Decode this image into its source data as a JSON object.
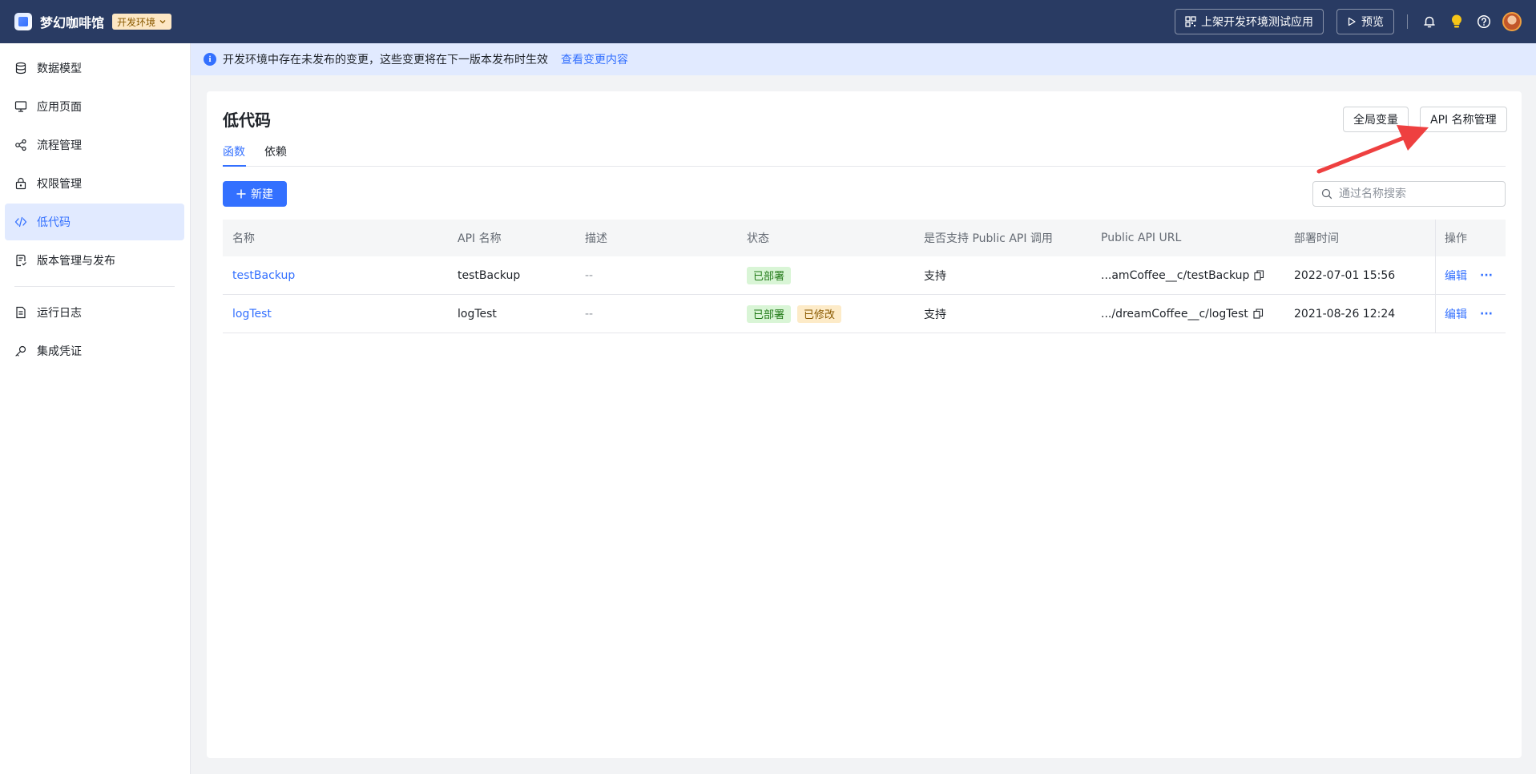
{
  "header": {
    "app_name": "梦幻咖啡馆",
    "env_label": "开发环境",
    "publish_test_app": "上架开发环境测试应用",
    "preview": "预览"
  },
  "sidebar": {
    "items": [
      {
        "label": "数据模型",
        "icon": "database-icon"
      },
      {
        "label": "应用页面",
        "icon": "monitor-icon"
      },
      {
        "label": "流程管理",
        "icon": "flow-icon"
      },
      {
        "label": "权限管理",
        "icon": "lock-icon"
      },
      {
        "label": "低代码",
        "icon": "code-icon",
        "active": true
      },
      {
        "label": "版本管理与发布",
        "icon": "version-icon"
      },
      {
        "label": "运行日志",
        "icon": "log-icon"
      },
      {
        "label": "集成凭证",
        "icon": "key-icon"
      }
    ]
  },
  "notice": {
    "text": "开发环境中存在未发布的变更，这些变更将在下一版本发布时生效",
    "link": "查看变更内容"
  },
  "main": {
    "title": "低代码",
    "global_vars": "全局变量",
    "api_name_mgmt": "API 名称管理",
    "tabs": [
      {
        "label": "函数",
        "active": true
      },
      {
        "label": "依赖",
        "active": false
      }
    ],
    "new_button": "新建",
    "search_placeholder": "通过名称搜索"
  },
  "table": {
    "headers": [
      "名称",
      "API 名称",
      "描述",
      "状态",
      "是否支持 Public API 调用",
      "Public API URL",
      "部署时间",
      "操作"
    ],
    "rows": [
      {
        "name": "testBackup",
        "api_name": "testBackup",
        "desc": "--",
        "status": [
          "已部署"
        ],
        "public_api": "支持",
        "url": "...amCoffee__c/testBackup",
        "deploy_time": "2022-07-01 15:56",
        "edit": "编辑",
        "more": "···"
      },
      {
        "name": "logTest",
        "api_name": "logTest",
        "desc": "--",
        "status": [
          "已部署",
          "已修改"
        ],
        "public_api": "支持",
        "url": ".../dreamCoffee__c/logTest",
        "deploy_time": "2021-08-26 12:24",
        "edit": "编辑",
        "more": "···"
      }
    ]
  },
  "colors": {
    "header_bg": "#293b63",
    "accent": "#3370ff",
    "arrow": "#ee4040"
  }
}
